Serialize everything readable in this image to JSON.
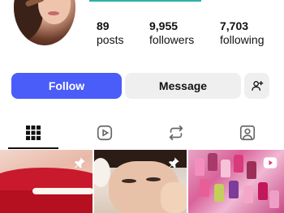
{
  "profile": {
    "stats": [
      {
        "value": "89",
        "label": "posts"
      },
      {
        "value": "9,955",
        "label": "followers"
      },
      {
        "value": "7,703",
        "label": "following"
      }
    ]
  },
  "actions": {
    "follow_label": "Follow",
    "message_label": "Message",
    "add_user_icon": "person-add-icon"
  },
  "tabs": [
    {
      "icon": "grid-icon",
      "active": true
    },
    {
      "icon": "reels-icon",
      "active": false
    },
    {
      "icon": "repost-icon",
      "active": false
    },
    {
      "icon": "tagged-icon",
      "active": false
    }
  ],
  "posts": [
    {
      "pinned": true,
      "type": "photo"
    },
    {
      "pinned": true,
      "type": "photo"
    },
    {
      "pinned": false,
      "type": "video"
    }
  ],
  "colors": {
    "accent": "#4a5df9",
    "secondary_button": "#efefef",
    "text": "#111111"
  }
}
